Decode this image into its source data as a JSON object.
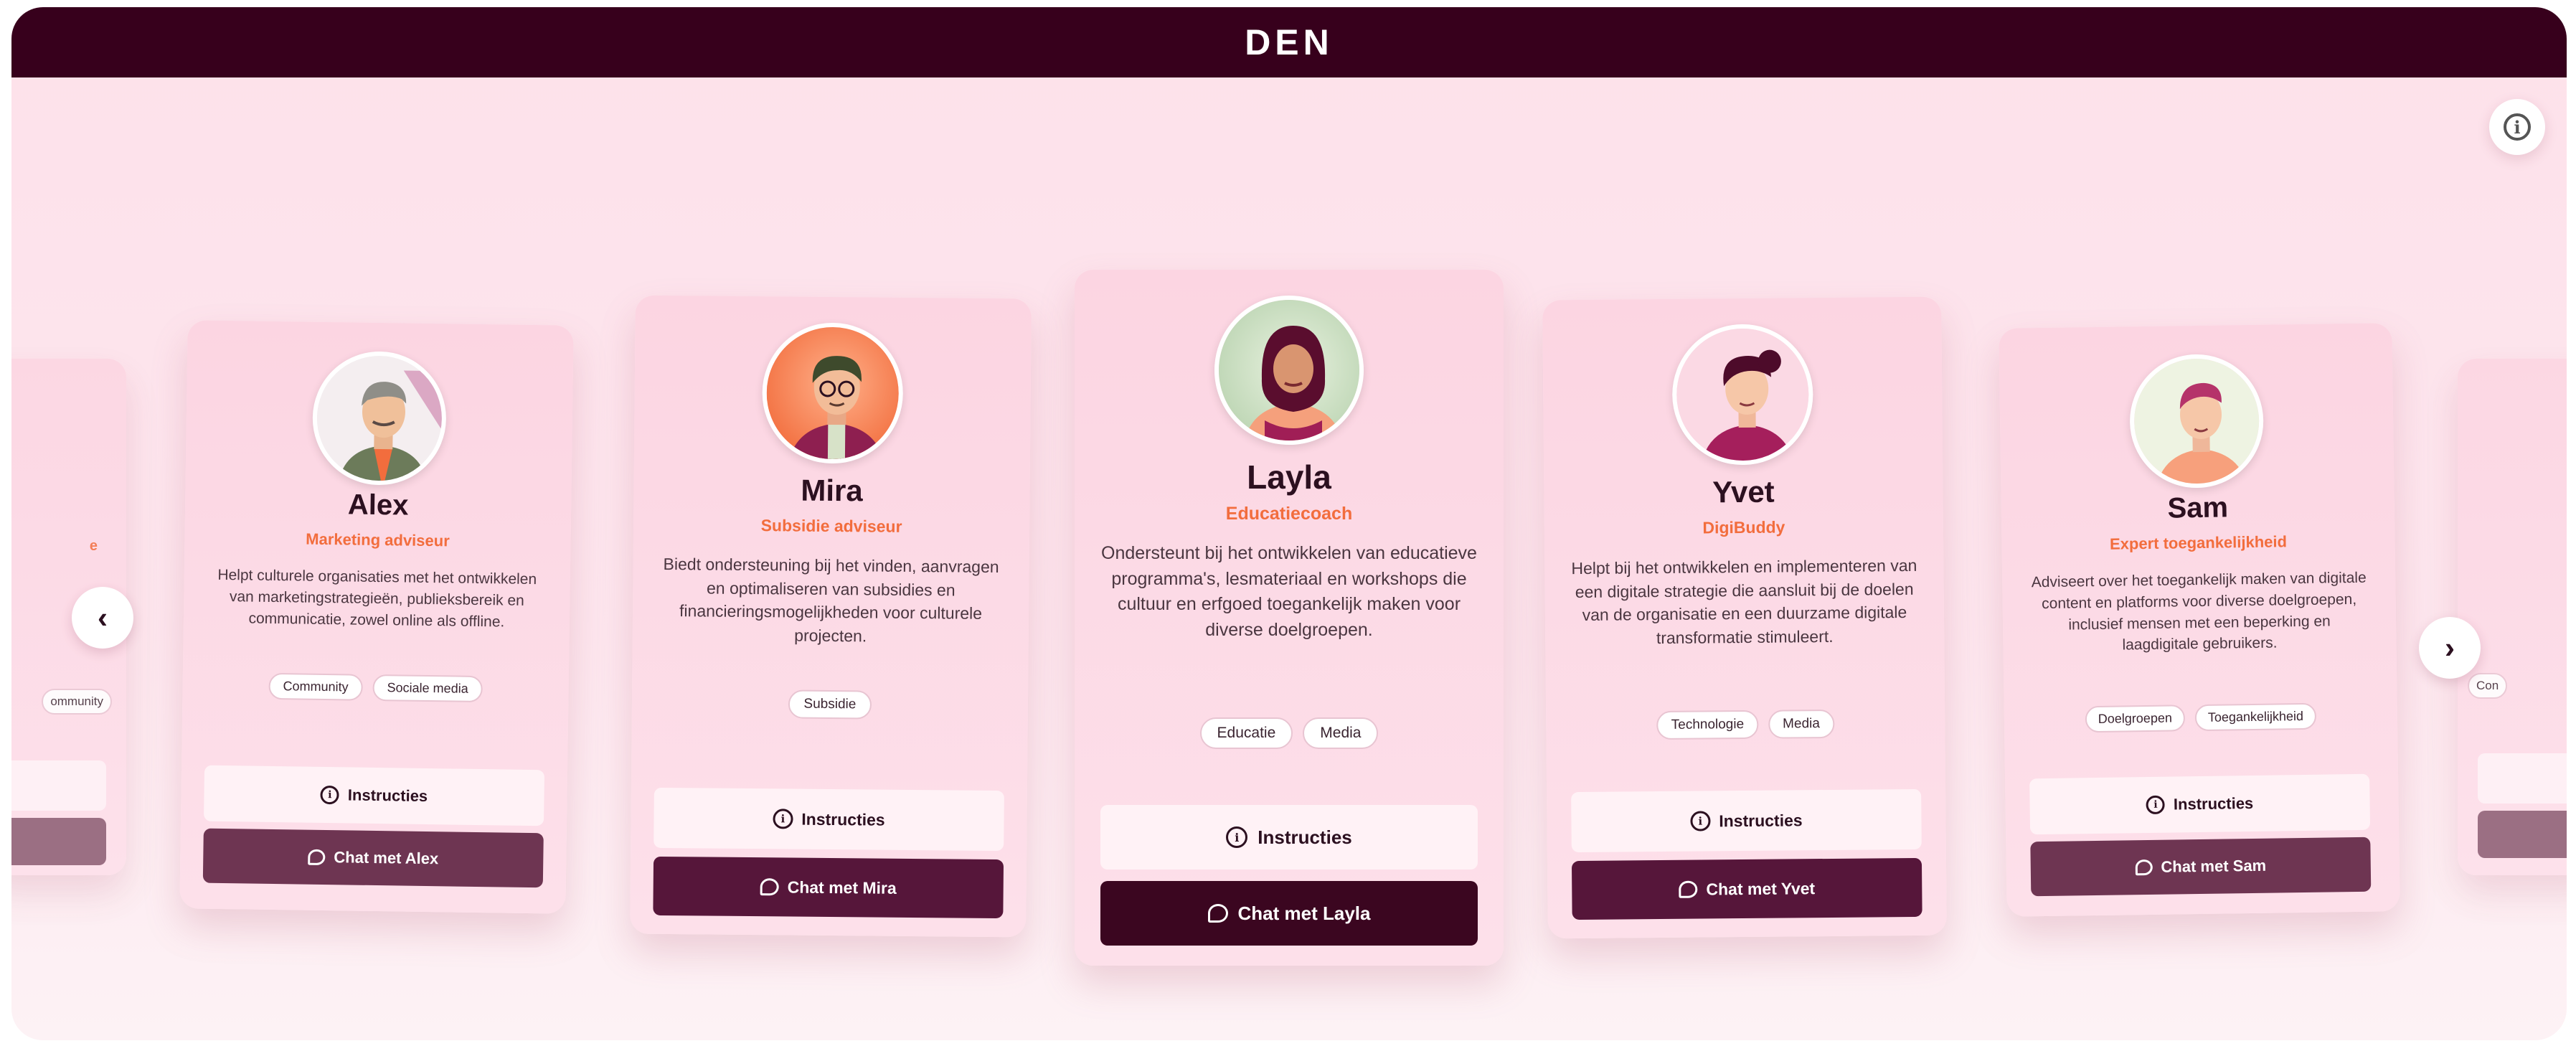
{
  "header": {
    "logo": "DEN"
  },
  "info_button": {
    "icon": "info-icon"
  },
  "nav": {
    "prev": "‹",
    "next": "›"
  },
  "partial_left": {
    "tag": "ommunity",
    "role": "e"
  },
  "partial_right": {
    "tag": "Con"
  },
  "agents": [
    {
      "name": "Alex",
      "role": "Marketing adviseur",
      "description": "Helpt culturele organisaties met het ontwikkelen van marketingstrategieën, publieksbereik en communicatie, zowel online als offline.",
      "tags": [
        "Community",
        "Sociale media"
      ],
      "instructions_label": "Instructies",
      "chat_label": "Chat met Alex"
    },
    {
      "name": "Mira",
      "role": "Subsidie adviseur",
      "description": "Biedt ondersteuning bij het vinden, aanvragen en optimaliseren van subsidies en financieringsmogelijkheden voor culturele projecten.",
      "tags": [
        "Subsidie"
      ],
      "instructions_label": "Instructies",
      "chat_label": "Chat met Mira"
    },
    {
      "name": "Layla",
      "role": "Educatiecoach",
      "description": "Ondersteunt bij het ontwikkelen van educatieve programma's, lesmateriaal en workshops die cultuur en erfgoed toegankelijk maken voor diverse doelgroepen.",
      "tags": [
        "Educatie",
        "Media"
      ],
      "instructions_label": "Instructies",
      "chat_label": "Chat met Layla"
    },
    {
      "name": "Yvet",
      "role": "DigiBuddy",
      "description": "Helpt bij het ontwikkelen en implementeren van een digitale strategie die aansluit bij de doelen van de organisatie en een duurzame digitale transformatie stimuleert.",
      "tags": [
        "Technologie",
        "Media"
      ],
      "instructions_label": "Instructies",
      "chat_label": "Chat met Yvet"
    },
    {
      "name": "Sam",
      "role": "Expert toegankelijkheid",
      "description": "Adviseert over het toegankelijk maken van digitale content en platforms voor diverse doelgroepen, inclusief mensen met een beperking en laagdigitale gebruikers.",
      "tags": [
        "Doelgroepen",
        "Toegankelijkheid"
      ],
      "instructions_label": "Instructies",
      "chat_label": "Chat met Sam"
    }
  ],
  "colors": {
    "header_bg": "#37001c",
    "accent_role": "#f26d3d",
    "chat_button_center": "#3b0620",
    "chat_button_near": "#5c1a3a",
    "chat_button_far": "#7a3a58"
  }
}
